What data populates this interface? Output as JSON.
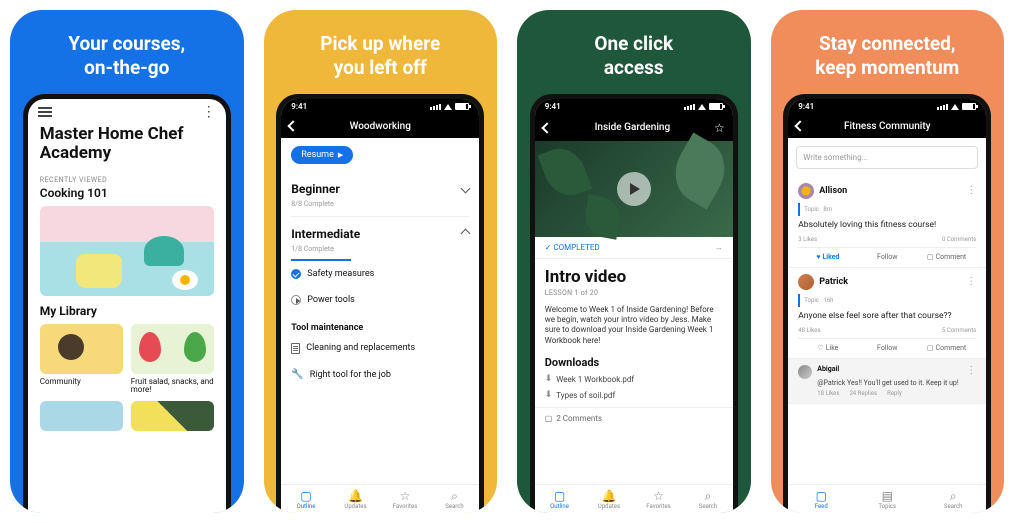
{
  "status_time": "9:41",
  "panels": [
    {
      "tagline": "Your courses,\non-the-go",
      "app_title": "Master Home Chef Academy",
      "recently_viewed_label": "Recently Viewed",
      "recent_course": "Cooking 101",
      "my_library_label": "My Library",
      "cards": [
        {
          "title": "Community"
        },
        {
          "title": "Fruit salad, snacks, and more!"
        }
      ]
    },
    {
      "tagline": "Pick up where\nyou left off",
      "header": "Woodworking",
      "resume": "Resume",
      "sections": [
        {
          "title": "Beginner",
          "progress": "8/8 Complete",
          "open": false
        },
        {
          "title": "Intermediate",
          "progress": "1/8 Complete",
          "open": true,
          "items": [
            {
              "label": "Safety measures",
              "done": true
            },
            {
              "label": "Power tools",
              "done": false,
              "icon": "play"
            }
          ],
          "sub": {
            "heading": "Tool maintenance",
            "items": [
              {
                "label": "Cleaning and replacements",
                "icon": "doc"
              },
              {
                "label": "Right tool for the job",
                "icon": "wrench"
              }
            ]
          }
        }
      ],
      "nav": [
        "Outline",
        "Updates",
        "Favorites",
        "Search"
      ]
    },
    {
      "tagline": "One click\naccess",
      "header": "Inside Gardening",
      "completed_label": "COMPLETED",
      "title": "Intro video",
      "lesson": "LESSON 1 of 20",
      "body": "Welcome to Week 1 of Inside Gardening! Before we begin, watch your intro video by Jess. Make sure to download your Inside Gardening Week 1 Workbook here!",
      "downloads_label": "Downloads",
      "downloads": [
        "Week 1 Workbook.pdf",
        "Types of soil.pdf"
      ],
      "comments": "2 Comments",
      "nav": [
        "Outline",
        "Updates",
        "Favorites",
        "Search"
      ]
    },
    {
      "tagline": "Stay connected,\nkeep momentum",
      "header": "Fitness Community",
      "write_placeholder": "Write something...",
      "posts": [
        {
          "name": "Allison",
          "topic": "Topic",
          "time": "8m",
          "body": "Absolutely loving this fitness course!",
          "likes": "3 Likes",
          "comments": "0 Comments",
          "actions": {
            "like": "Liked",
            "follow": "Follow",
            "comment": "Comment"
          },
          "liked": true
        },
        {
          "name": "Patrick",
          "topic": "Topic",
          "time": "16h",
          "body": "Anyone else feel sore after that course??",
          "likes": "48 Likes",
          "comments": "5 Comments",
          "actions": {
            "like": "Like",
            "follow": "Follow",
            "comment": "Comment"
          }
        }
      ],
      "reply": {
        "name": "Abigail",
        "body": "@Patrick Yes!! You'll get used to it. Keep it up!",
        "likes": "18 Likes",
        "replies": "24 Replies",
        "reply": "Reply"
      },
      "nav": [
        "Feed",
        "Topics",
        "Search"
      ]
    }
  ]
}
